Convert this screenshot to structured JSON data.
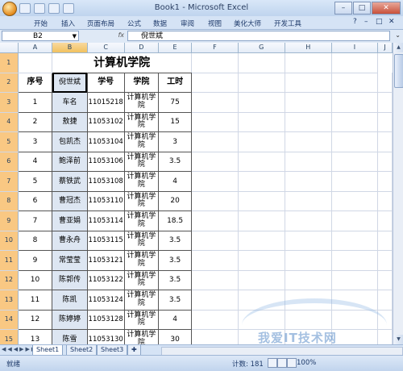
{
  "window": {
    "title": "Book1 - Microsoft Excel",
    "minimize": "–",
    "maximize": "□",
    "close": "✕"
  },
  "ribbon_tabs": [
    "开始",
    "插入",
    "页面布局",
    "公式",
    "数据",
    "审阅",
    "视图",
    "美化大师",
    "开发工具"
  ],
  "ribbon_controls": [
    "?",
    "–",
    "□",
    "✕"
  ],
  "formula_bar": {
    "name_box": "B2",
    "fx_label": "fx",
    "content": "倪世斌"
  },
  "columns": [
    "A",
    "B",
    "C",
    "D",
    "E",
    "F",
    "G",
    "H",
    "I",
    "J"
  ],
  "title_row": {
    "row": "1",
    "text": "计算机学院"
  },
  "header_row": {
    "row": "2",
    "cells": [
      "序号",
      "倪世斌",
      "学号",
      "学院",
      "工时"
    ]
  },
  "rows": [
    {
      "row": "3",
      "cells": [
        "1",
        "车名",
        "11015218",
        "计算机学院",
        "75"
      ]
    },
    {
      "row": "4",
      "cells": [
        "2",
        "敖捷",
        "11053102",
        "计算机学院",
        "15"
      ]
    },
    {
      "row": "5",
      "cells": [
        "3",
        "包凯杰",
        "11053104",
        "计算机学院",
        "3"
      ]
    },
    {
      "row": "6",
      "cells": [
        "4",
        "鲍泽前",
        "11053106",
        "计算机学院",
        "3.5"
      ]
    },
    {
      "row": "7",
      "cells": [
        "5",
        "蔡铁武",
        "11053108",
        "计算机学院",
        "4"
      ]
    },
    {
      "row": "8",
      "cells": [
        "6",
        "曹冠杰",
        "11053110",
        "计算机学院",
        "20"
      ]
    },
    {
      "row": "9",
      "cells": [
        "7",
        "曹亚娟",
        "11053114",
        "计算机学院",
        "18.5"
      ]
    },
    {
      "row": "10",
      "cells": [
        "8",
        "曹永舟",
        "11053115",
        "计算机学院",
        "3.5"
      ]
    },
    {
      "row": "11",
      "cells": [
        "9",
        "常莹莹",
        "11053121",
        "计算机学院",
        "3.5"
      ]
    },
    {
      "row": "12",
      "cells": [
        "10",
        "陈郭传",
        "11053122",
        "计算机学院",
        "3.5"
      ]
    },
    {
      "row": "13",
      "cells": [
        "11",
        "陈凯",
        "11053124",
        "计算机学院",
        "3.5"
      ]
    },
    {
      "row": "14",
      "cells": [
        "12",
        "陈婷婷",
        "11053128",
        "计算机学院",
        "4"
      ]
    },
    {
      "row": "15",
      "cells": [
        "13",
        "陈雪",
        "11053130",
        "计算机学院",
        "30"
      ]
    }
  ],
  "sheet_tabs": [
    "Sheet1",
    "Sheet2",
    "Sheet3"
  ],
  "status": {
    "ready": "就绪",
    "count": "计数: 181",
    "zoom": "100%"
  },
  "watermark": "我爱IT技术网",
  "colors": {
    "selected_header": "#f9c883",
    "grid_line": "#d0d7e5",
    "chrome": "#c5d6ec"
  }
}
